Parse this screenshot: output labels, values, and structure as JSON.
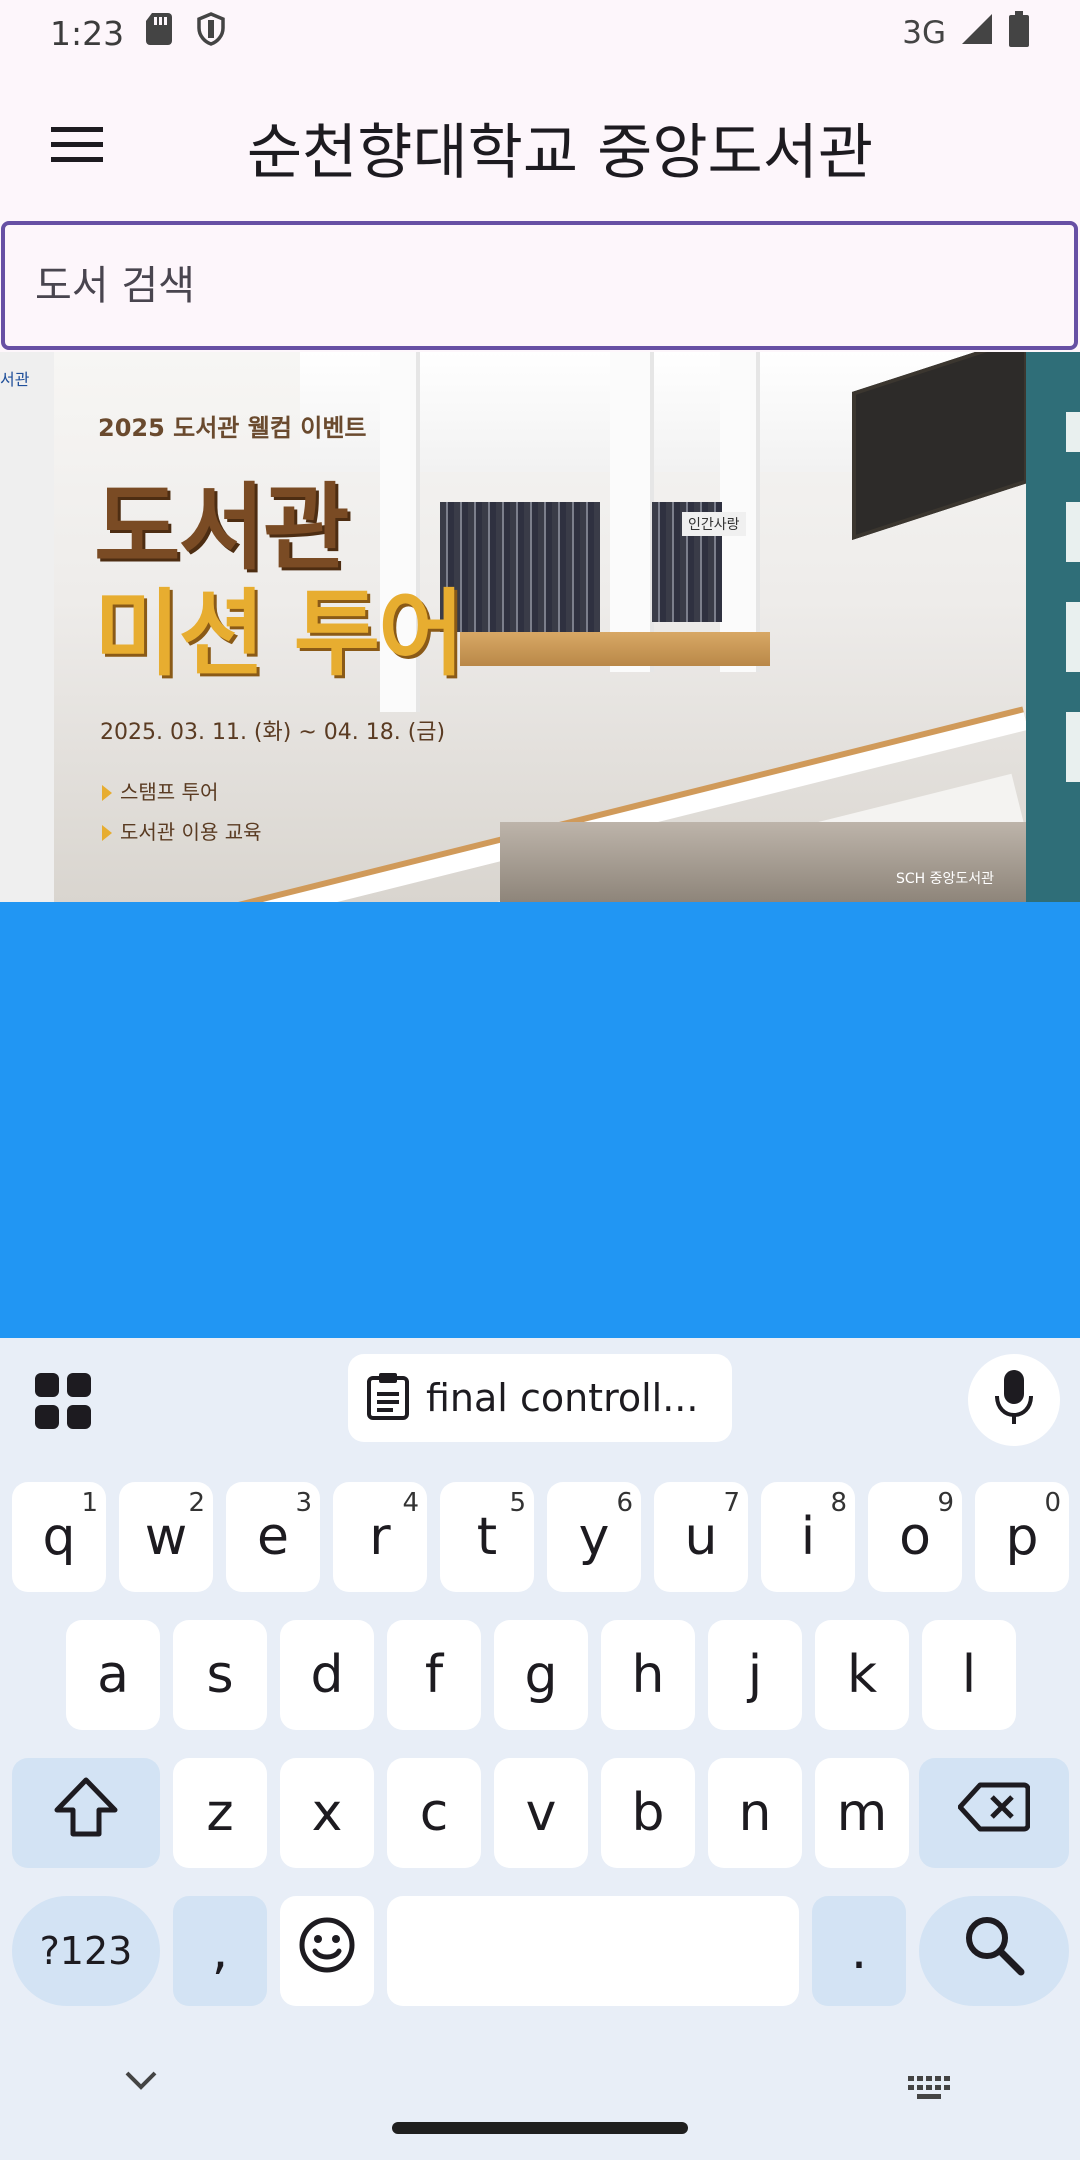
{
  "status_bar": {
    "time": "1:23",
    "network": "3G"
  },
  "app_bar": {
    "title": "순천향대학교 중앙도서관"
  },
  "search": {
    "placeholder": "도서 검색",
    "value": ""
  },
  "banner": {
    "subtitle": "2025 도서관 웰컴 이벤트",
    "headline_1": "도서관",
    "headline_2": "미션 투어",
    "date_range": "2025. 03. 11. (화) ~ 04. 18. (금)",
    "items": [
      "스탬프 투어",
      "도서관 이용 교육"
    ],
    "sign": "인간사랑",
    "logo": "SCH 중앙도서관",
    "edge_left_text": "서관"
  },
  "keyboard": {
    "clipboard_suggestion": "final controll...",
    "rows": [
      [
        {
          "label": "q",
          "hint": "1"
        },
        {
          "label": "w",
          "hint": "2"
        },
        {
          "label": "e",
          "hint": "3"
        },
        {
          "label": "r",
          "hint": "4"
        },
        {
          "label": "t",
          "hint": "5"
        },
        {
          "label": "y",
          "hint": "6"
        },
        {
          "label": "u",
          "hint": "7"
        },
        {
          "label": "i",
          "hint": "8"
        },
        {
          "label": "o",
          "hint": "9"
        },
        {
          "label": "p",
          "hint": "0"
        }
      ],
      [
        {
          "label": "a"
        },
        {
          "label": "s"
        },
        {
          "label": "d"
        },
        {
          "label": "f"
        },
        {
          "label": "g"
        },
        {
          "label": "h"
        },
        {
          "label": "j"
        },
        {
          "label": "k"
        },
        {
          "label": "l"
        }
      ],
      [
        {
          "label": "z"
        },
        {
          "label": "x"
        },
        {
          "label": "c"
        },
        {
          "label": "v"
        },
        {
          "label": "b"
        },
        {
          "label": "n"
        },
        {
          "label": "m"
        }
      ]
    ],
    "symbols_label": "?123",
    "comma_label": ",",
    "period_label": "."
  },
  "colors": {
    "accent": "#6750a4",
    "content_blue": "#2196f3",
    "keyboard_bg": "#e8eef7",
    "modifier_key": "#d3e3f4"
  },
  "icons": {
    "status": [
      "sd-card-icon",
      "shield-icon",
      "signal-icon",
      "battery-icon"
    ],
    "app_bar": "menu-icon",
    "keyboard": [
      "apps-grid-icon",
      "clipboard-icon",
      "mic-icon",
      "shift-icon",
      "backspace-icon",
      "emoji-icon",
      "search-icon",
      "chevron-down-icon",
      "keyboard-switch-icon"
    ]
  }
}
